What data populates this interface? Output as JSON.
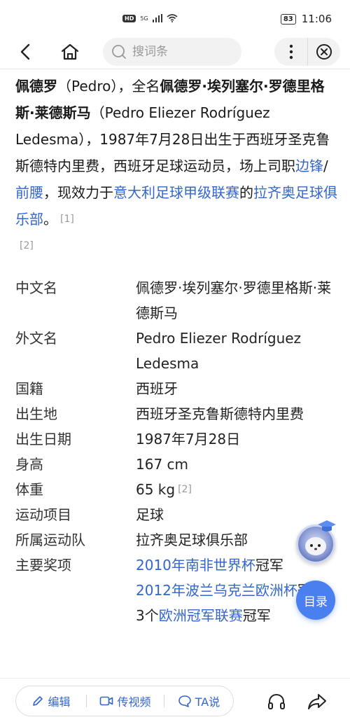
{
  "status_bar": {
    "hd": "HD",
    "network": "5G",
    "battery": "83",
    "time": "11:06"
  },
  "nav": {
    "search_placeholder": "搜词条"
  },
  "intro": {
    "name_cn": "佩德罗",
    "name_en_paren": "（Pedro），全名",
    "full_name_cn": "佩德罗·埃列塞尔·罗德里格斯·莱德斯马",
    "full_name_en": "（Pedro Eliezer Rodríguez Ledesma），1987年7月28日出生于西班牙圣克鲁斯德特内里费，西班牙足球运动员，场上司职",
    "pos1": "边锋",
    "slash": "/",
    "pos2": "前腰",
    "text3": "，现效力于",
    "league": "意大利足球甲级联赛",
    "text4": "的",
    "club": "拉齐奥足球俱乐部",
    "text5": "。",
    "ref1": "[1]",
    "ref2": "[2]"
  },
  "info": {
    "rows": [
      {
        "key": "中文名",
        "value": "佩德罗·埃列塞尔·罗德里格斯·莱德斯马"
      },
      {
        "key": "外文名",
        "value": "Pedro Eliezer Rodríguez Ledesma"
      },
      {
        "key": "国籍",
        "value": "西班牙"
      },
      {
        "key": "出生地",
        "value": "西班牙圣克鲁斯德特内里费"
      },
      {
        "key": "出生日期",
        "value": "1987年7月28日"
      },
      {
        "key": "身高",
        "value": "167 cm"
      },
      {
        "key": "体重",
        "value": "65 kg"
      },
      {
        "key": "运动项目",
        "value": "足球"
      },
      {
        "key": "所属运动队",
        "value": "拉齐奥足球俱乐部"
      },
      {
        "key": "主要奖项",
        "value": ""
      }
    ],
    "weight_ref": "[2]",
    "award1_link": "2010年南非世界杯",
    "award1_suffix": "冠军",
    "award2_link": "2012年波兰乌克兰欧洲杯",
    "award2_suffix": "冠军",
    "award3_prefix": "3个",
    "award3_link": "欧洲冠军联赛",
    "award3_suffix": "冠军"
  },
  "float": {
    "toc_label": "目录"
  },
  "bottom": {
    "edit": "编辑",
    "video": "传视频",
    "ta": "TA说"
  },
  "colors": {
    "link": "#3366cc",
    "toc": "#4a7ff0"
  }
}
